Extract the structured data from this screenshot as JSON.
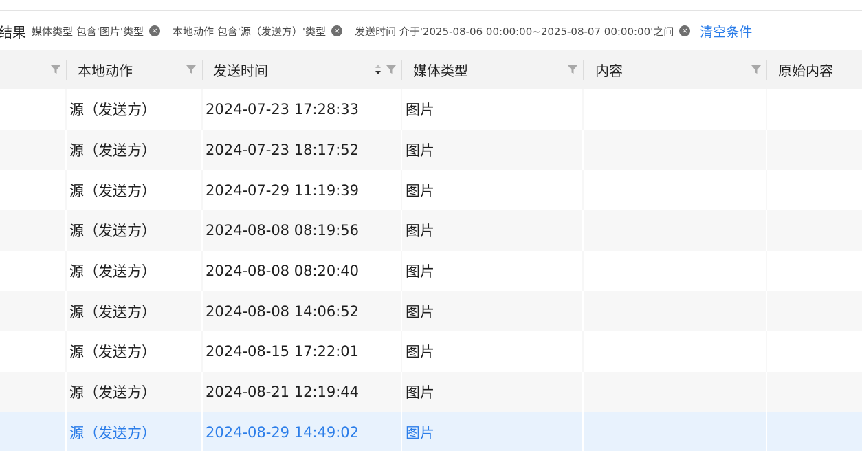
{
  "filter": {
    "title": "结果",
    "chips": [
      {
        "label": "媒体类型 包含'图片'类型"
      },
      {
        "label": "本地动作 包含'源（发送方）'类型"
      },
      {
        "label": "发送时间 介于'2025-08-06 00:00:00~2025-08-07 00:00:00'之间"
      }
    ],
    "close_glyph": "×",
    "clear_label": "清空条件"
  },
  "table": {
    "columns": [
      {
        "label": ""
      },
      {
        "label": "本地动作"
      },
      {
        "label": "发送时间"
      },
      {
        "label": "媒体类型"
      },
      {
        "label": "内容"
      },
      {
        "label": "原始内容"
      }
    ],
    "rows": [
      {
        "action": "源（发送方）",
        "time": "2024-07-23 17:28:33",
        "media": "图片",
        "content": "",
        "raw": ""
      },
      {
        "action": "源（发送方）",
        "time": "2024-07-23 18:17:52",
        "media": "图片",
        "content": "",
        "raw": ""
      },
      {
        "action": "源（发送方）",
        "time": "2024-07-29 11:19:39",
        "media": "图片",
        "content": "",
        "raw": ""
      },
      {
        "action": "源（发送方）",
        "time": "2024-08-08 08:19:56",
        "media": "图片",
        "content": "",
        "raw": ""
      },
      {
        "action": "源（发送方）",
        "time": "2024-08-08 08:20:40",
        "media": "图片",
        "content": "",
        "raw": ""
      },
      {
        "action": "源（发送方）",
        "time": "2024-08-08 14:06:52",
        "media": "图片",
        "content": "",
        "raw": ""
      },
      {
        "action": "源（发送方）",
        "time": "2024-08-15 17:22:01",
        "media": "图片",
        "content": "",
        "raw": ""
      },
      {
        "action": "源（发送方）",
        "time": "2024-08-21 12:19:44",
        "media": "图片",
        "content": "",
        "raw": ""
      },
      {
        "action": "源（发送方）",
        "time": "2024-08-29 14:49:02",
        "media": "图片",
        "content": "",
        "raw": ""
      }
    ],
    "selected_row": 8,
    "sort_column": "发送时间",
    "sort_direction": "descending"
  },
  "colors": {
    "accent": "#2b7de9",
    "header_bg": "#f3f3f3",
    "row_alt_bg": "#f7f7f7",
    "selected_bg": "#e8f2fd"
  },
  "icons": {
    "filter": "funnel-icon",
    "sort": "sort-caret-icon",
    "chip_close": "close-circle-icon"
  }
}
